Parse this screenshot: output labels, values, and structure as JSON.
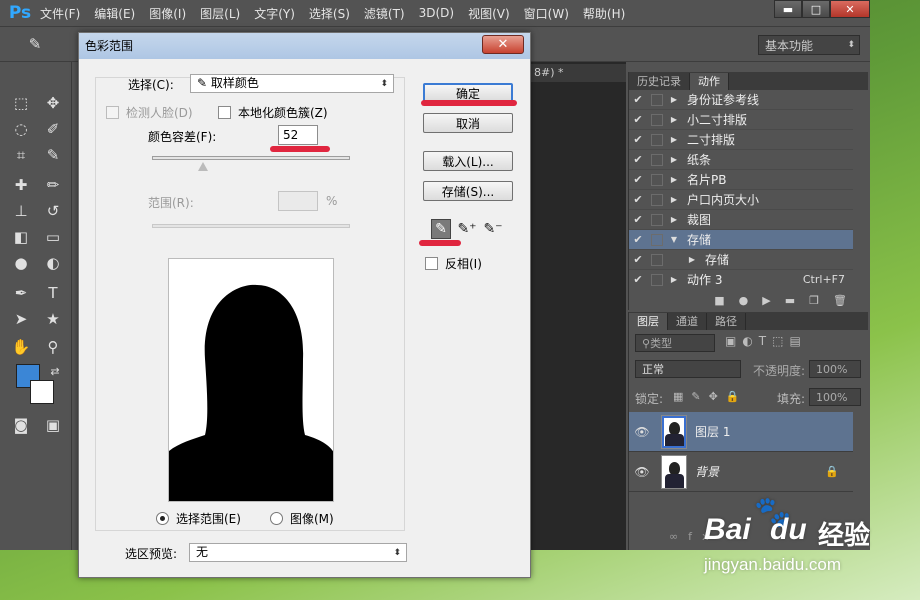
{
  "app": {
    "logo": "Ps"
  },
  "menu": [
    "文件(F)",
    "编辑(E)",
    "图像(I)",
    "图层(L)",
    "文字(Y)",
    "选择(S)",
    "滤镜(T)",
    "3D(D)",
    "视图(V)",
    "窗口(W)",
    "帮助(H)"
  ],
  "window_buttons": {
    "minimize": "▬",
    "maximize": "□",
    "close": "✕"
  },
  "options_bar": {
    "workspace": "基本功能"
  },
  "document": {
    "tab_label": "8#) *"
  },
  "colors": {
    "foreground": "#3b86d6",
    "background": "#ffffff",
    "accent_select": "#5e7390",
    "annotation_red": "#e0263f"
  },
  "actions_panel": {
    "tabs": [
      "历史记录",
      "动作"
    ],
    "active_tab": "动作",
    "items": [
      {
        "label": "身份证参考线",
        "shortcut": "",
        "level": 0,
        "expanded": false,
        "selected": false
      },
      {
        "label": "小二寸排版",
        "shortcut": "",
        "level": 0,
        "expanded": false,
        "selected": false
      },
      {
        "label": "二寸排版",
        "shortcut": "",
        "level": 0,
        "expanded": false,
        "selected": false
      },
      {
        "label": "纸条",
        "shortcut": "",
        "level": 0,
        "expanded": false,
        "selected": false
      },
      {
        "label": "名片PB",
        "shortcut": "",
        "level": 0,
        "expanded": false,
        "selected": false
      },
      {
        "label": "户口内页大小",
        "shortcut": "",
        "level": 0,
        "expanded": false,
        "selected": false
      },
      {
        "label": "裁图",
        "shortcut": "",
        "level": 0,
        "expanded": false,
        "selected": false
      },
      {
        "label": "存储",
        "shortcut": "",
        "level": 0,
        "expanded": true,
        "selected": true
      },
      {
        "label": "存储",
        "shortcut": "",
        "level": 1,
        "expanded": false,
        "selected": false
      },
      {
        "label": "动作 3",
        "shortcut": "Ctrl+F7",
        "level": 0,
        "expanded": false,
        "selected": false
      }
    ]
  },
  "layers_panel": {
    "tabs": [
      "图层",
      "通道",
      "路径"
    ],
    "active_tab": "图层",
    "filter_label": "类型",
    "blend_mode": "正常",
    "opacity_label": "不透明度:",
    "opacity_value": "100%",
    "lock_label": "锁定:",
    "fill_label": "填充:",
    "fill_value": "100%",
    "layers": [
      {
        "name": "图层 1",
        "selected": true,
        "locked": false
      },
      {
        "name": "背景",
        "selected": false,
        "locked": true
      }
    ]
  },
  "color_range_dialog": {
    "title": "色彩范围",
    "select_label": "选择(C):",
    "select_value": "取样颜色",
    "detect_faces_label": "检测人脸(D)",
    "localized_label": "本地化颜色簇(Z)",
    "fuzziness_label": "颜色容差(F):",
    "fuzziness_value": "52",
    "fuzziness_fraction": 0.26,
    "range_label": "范围(R):",
    "range_unit": "%",
    "ok_label": "确定",
    "cancel_label": "取消",
    "load_label": "载入(L)...",
    "save_label": "存储(S)...",
    "invert_label": "反相(I)",
    "radio_selection_label": "选择范围(E)",
    "radio_image_label": "图像(M)",
    "preview_label": "选区预览:",
    "preview_value": "无"
  },
  "watermark": {
    "brand_main": "Bai",
    "brand_paw": "du",
    "brand_cn": "经验",
    "url": "jingyan.baidu.com"
  }
}
